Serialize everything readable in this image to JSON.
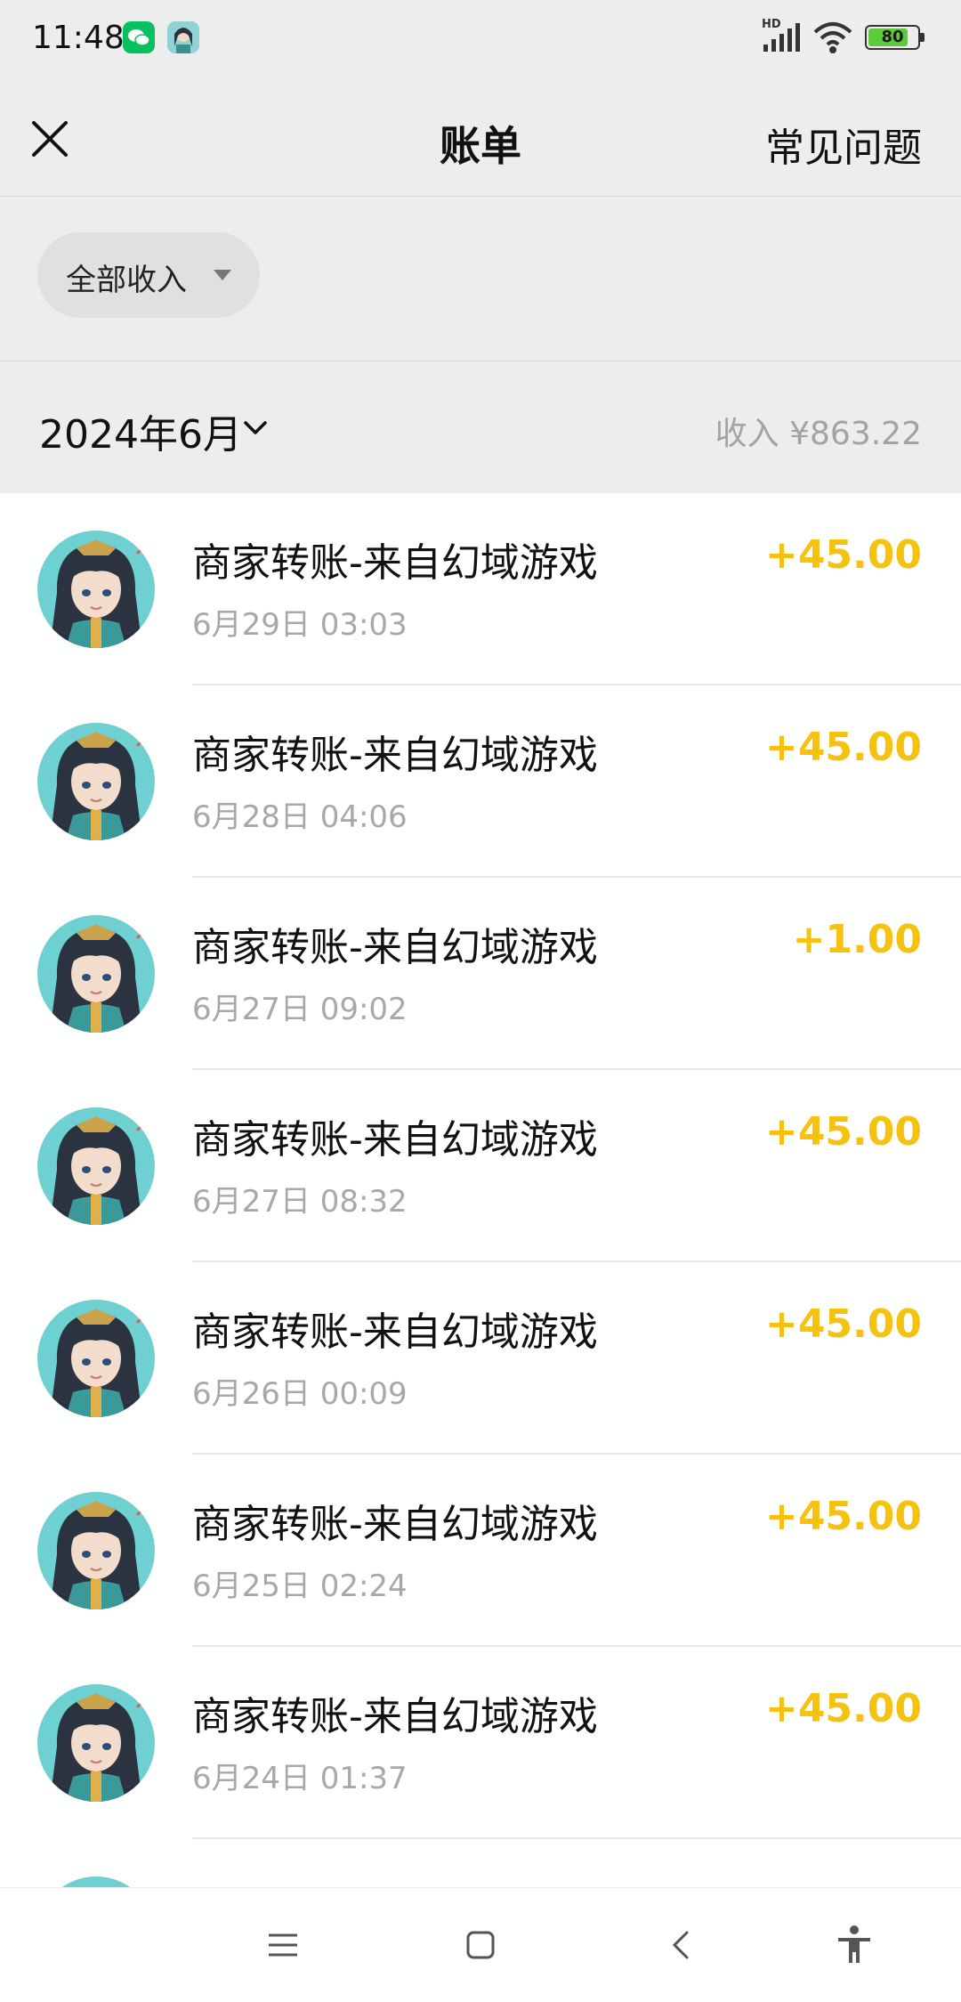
{
  "status_bar": {
    "time": "11:48",
    "network_label": "HD",
    "battery": "80",
    "icons": [
      "wechat-icon",
      "avatar-notification-icon",
      "signal-icon",
      "wifi-icon",
      "battery-icon"
    ]
  },
  "header": {
    "title": "账单",
    "faq_label": "常见问题",
    "close_icon": "close-icon"
  },
  "filter": {
    "selected": "全部收入"
  },
  "month_section": {
    "month": "2024年6月",
    "income_summary": "收入 ¥863.22"
  },
  "transactions": [
    {
      "title": "商家转账-来自幻域游戏",
      "time": "6月29日 03:03",
      "amount": "+45.00"
    },
    {
      "title": "商家转账-来自幻域游戏",
      "time": "6月28日 04:06",
      "amount": "+45.00"
    },
    {
      "title": "商家转账-来自幻域游戏",
      "time": "6月27日 09:02",
      "amount": "+1.00"
    },
    {
      "title": "商家转账-来自幻域游戏",
      "time": "6月27日 08:32",
      "amount": "+45.00"
    },
    {
      "title": "商家转账-来自幻域游戏",
      "time": "6月26日 00:09",
      "amount": "+45.00"
    },
    {
      "title": "商家转账-来自幻域游戏",
      "time": "6月25日 02:24",
      "amount": "+45.00"
    },
    {
      "title": "商家转账-来自幻域游戏",
      "time": "6月24日 01:37",
      "amount": "+45.00"
    }
  ],
  "colors": {
    "amount": "#f5c20f",
    "header_bg": "#ededed",
    "secondary_text": "#a8a8a8",
    "avatar_bg": "#6ed0d0"
  },
  "bottom_nav": {
    "icons": [
      "menu-icon",
      "home-icon",
      "back-icon",
      "accessibility-icon"
    ]
  }
}
